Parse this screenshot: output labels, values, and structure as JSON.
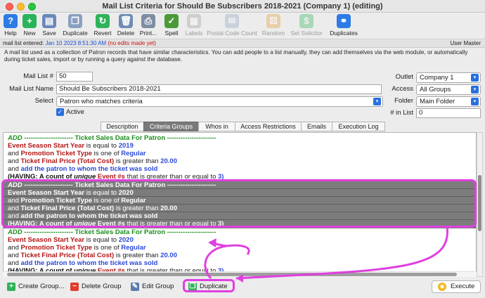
{
  "window": {
    "title": "Mail List Criteria for Should Be Subscribers 2018-2021 (Company 1) (editing)"
  },
  "toolbar": {
    "items": [
      {
        "label": "Help",
        "icon": "help-icon",
        "color": "#2d7be5",
        "glyph": "?"
      },
      {
        "label": "New",
        "icon": "new-icon",
        "color": "#29b35b",
        "glyph": "+"
      },
      {
        "label": "Save",
        "icon": "save-icon",
        "color": "#6a88b8",
        "glyph": "▤"
      },
      {
        "label": "Duplicate",
        "icon": "duplicate-icon",
        "color": "#8aa0c0",
        "glyph": "❐"
      },
      {
        "label": "Revert",
        "icon": "revert-icon",
        "color": "#2fb35a",
        "glyph": "↻"
      },
      {
        "label": "Delete",
        "icon": "delete-icon",
        "color": "#6e8db4",
        "glyph": "🗑"
      },
      {
        "label": "Print...",
        "icon": "print-icon",
        "color": "#7d8ea3",
        "glyph": "⎙"
      },
      {
        "label": "Spell",
        "icon": "spell-icon",
        "color": "#4b9a3a",
        "glyph": "✓"
      },
      {
        "label": "Labels",
        "icon": "labels-icon",
        "color": "#999999",
        "glyph": "▦"
      },
      {
        "label": "Postal Code Count",
        "icon": "postal-code-icon",
        "color": "#8aa0c0",
        "glyph": "✉"
      },
      {
        "label": "Random",
        "icon": "random-icon",
        "color": "#e09a2a",
        "glyph": "⚄"
      },
      {
        "label": "Set Solicitor",
        "icon": "set-solicitor-icon",
        "color": "#2fb35a",
        "glyph": "$"
      },
      {
        "label": "Duplicates",
        "icon": "duplicates-icon",
        "color": "#2d7be5",
        "glyph": "⚭"
      }
    ]
  },
  "infobar": {
    "entered_label": "mail list entered:",
    "entered_date": "Jan 10 2023 8:51:30 AM",
    "edits_note": "(no edits made yet)",
    "user": "User Master"
  },
  "description": "A mail list used as a collection of Patron records that have similar characteristics.  You can add people to a list manually, they can add themselves via the web module, or automatically during ticket sales, import or by running a query against the database.",
  "form": {
    "mail_list_num_label": "Mail List #",
    "mail_list_num": "50",
    "mail_list_name_label": "Mail List Name",
    "mail_list_name": "Should Be Subscribers 2018-2021",
    "select_label": "Select",
    "select_value": "Patron who matches criteria",
    "active_label": "Active",
    "outlet_label": "Outlet",
    "outlet_value": "Company 1",
    "access_label": "Access",
    "access_value": "All Groups",
    "folder_label": "Folder",
    "folder_value": "Main Folder",
    "in_list_label": "# in List",
    "in_list_value": "0"
  },
  "tabs": [
    "Description",
    "Criteria Groups",
    "Whos in",
    "Access Restrictions",
    "Emails",
    "Execution Log"
  ],
  "criteria_groups": [
    {
      "header_add": "ADD",
      "header_text": "---------------------- Ticket Sales Data For Patron ----------------------",
      "lines": [
        {
          "pre": "",
          "field": "Event Season Start Year",
          "op": "is equal to",
          "value": "2019"
        },
        {
          "pre": "and",
          "field": "Promotion Ticket Type",
          "op": "is one of",
          "value": "Regular"
        },
        {
          "pre": "and",
          "field": "Ticket Final Price (Total Cost)",
          "op": "is greater than",
          "value": "20.00"
        },
        {
          "pre": "and",
          "field": "",
          "op": "",
          "value": "add the patron to whom the ticket was sold"
        }
      ],
      "having_a": "(HAVING: A count of",
      "having_u": "unique",
      "having_b": "Event #s",
      "having_c": "that is greater than or equal to",
      "having_v": "3)"
    },
    {
      "header_add": "ADD",
      "header_text": "---------------------- Ticket Sales Data For Patron ----------------------",
      "lines": [
        {
          "pre": "",
          "field": "Event Season Start Year",
          "op": "is equal to",
          "value": "2020"
        },
        {
          "pre": "and",
          "field": "Promotion Ticket Type",
          "op": "is one of",
          "value": "Regular"
        },
        {
          "pre": "and",
          "field": "Ticket Final Price (Total Cost)",
          "op": "is greater than",
          "value": "20.00"
        },
        {
          "pre": "and",
          "field": "",
          "op": "",
          "value": "add the patron to whom the ticket was sold"
        }
      ],
      "having_a": "(HAVING: A count of",
      "having_u": "unique",
      "having_b": "Event #s",
      "having_c": "that is greater than or equal to",
      "having_v": "3)"
    },
    {
      "header_add": "ADD",
      "header_text": "---------------------- Ticket Sales Data For Patron ----------------------",
      "lines": [
        {
          "pre": "",
          "field": "Event Season Start Year",
          "op": "is equal to",
          "value": "2020"
        },
        {
          "pre": "and",
          "field": "Promotion Ticket Type",
          "op": "is one of",
          "value": "Regular"
        },
        {
          "pre": "and",
          "field": "Ticket Final Price (Total Cost)",
          "op": "is greater than",
          "value": "20.00"
        },
        {
          "pre": "and",
          "field": "",
          "op": "",
          "value": "add the patron to whom the ticket was sold"
        }
      ],
      "having_a": "(HAVING: A count of",
      "having_u": "unique",
      "having_b": "Event #s",
      "having_c": "that is greater than or equal to",
      "having_v": "3)"
    }
  ],
  "bottom": {
    "create_group": "Create Group...",
    "delete_group": "Delete Group",
    "edit_group": "Edit Group",
    "duplicate": "Duplicate",
    "execute": "Execute"
  },
  "colors": {
    "highlight": "#e040e0",
    "selected_group": "#7c7c7c",
    "field": "#b31515",
    "value": "#2b49d8",
    "header": "#1d8f1d"
  }
}
